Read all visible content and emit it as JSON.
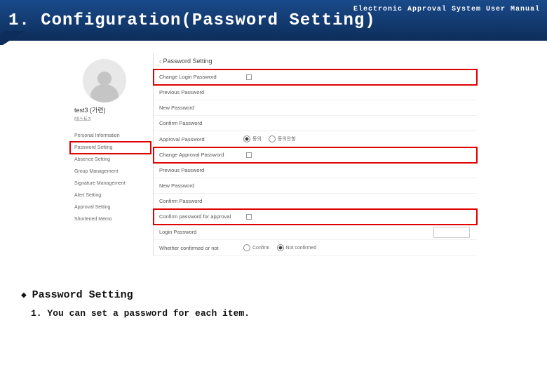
{
  "header": {
    "title": "1. Configuration(Password Setting)",
    "subtitle": "Electronic Approval System User Manual"
  },
  "profile": {
    "username": "test3 (가련)",
    "company": "테스트3"
  },
  "sidebar": {
    "items": [
      {
        "label": "Personal Information"
      },
      {
        "label": "Password Setting"
      },
      {
        "label": "Absence Setting"
      },
      {
        "label": "Group Management"
      },
      {
        "label": "Signature Management"
      },
      {
        "label": "Alert Setting"
      },
      {
        "label": "Approval Setting"
      },
      {
        "label": "Shortened Memo"
      }
    ]
  },
  "panel": {
    "title": "Password Setting",
    "sections": {
      "login": {
        "header": "Change Login Password",
        "prev": "Previous Password",
        "new": "New Password",
        "confirm": "Confirm Password"
      },
      "approvalRadio": {
        "label": "Approval Password",
        "opt1": "동의",
        "opt2": "동의안함"
      },
      "approval": {
        "header": "Change Approval Password",
        "prev": "Previous Password",
        "new": "New Password",
        "confirm": "Confirm Password"
      },
      "confirmApproval": {
        "label": "Confirm password for approval"
      },
      "loginPw": {
        "label": "Login Password"
      },
      "whether": {
        "label": "Whether confirmed or not",
        "opt1": "Confirm",
        "opt2": "Not confirmed"
      }
    }
  },
  "notes": {
    "heading": "Password Setting",
    "line1": "1. You can set a password for each item."
  }
}
